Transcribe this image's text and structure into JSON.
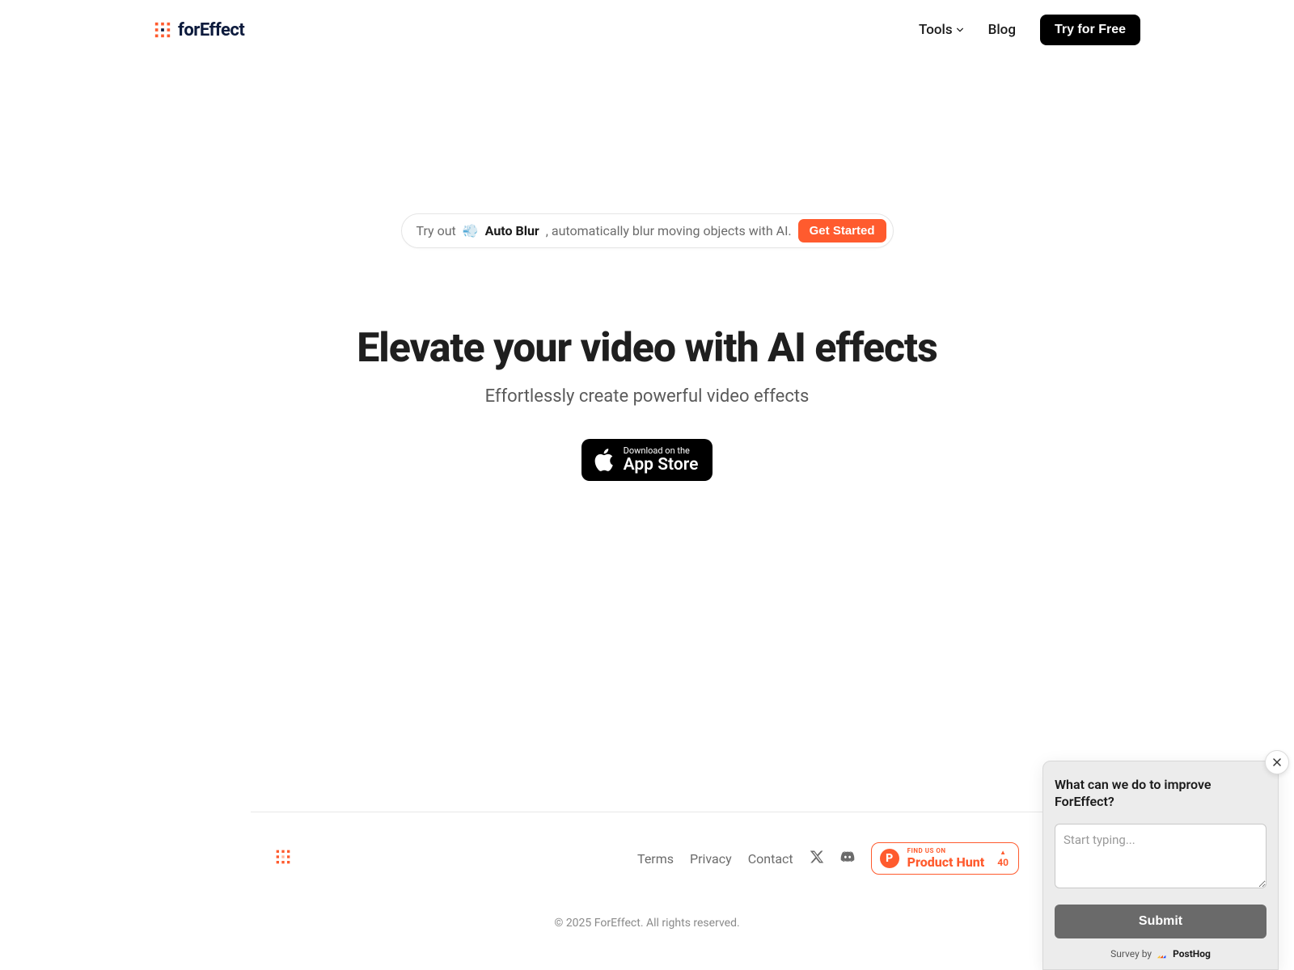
{
  "header": {
    "brand": "forEffect",
    "nav": {
      "tools": "Tools",
      "blog": "Blog",
      "cta": "Try for Free"
    }
  },
  "hero": {
    "pill_prefix": "Try out ",
    "pill_emoji": "💨",
    "pill_bold": "Auto Blur",
    "pill_suffix": ", automatically blur moving objects with AI.",
    "pill_cta": "Get Started",
    "title": "Elevate your video with AI effects",
    "subtitle": "Effortlessly create powerful video effects",
    "appstore_small": "Download on the",
    "appstore_big": "App Store"
  },
  "footer": {
    "links": {
      "terms": "Terms",
      "privacy": "Privacy",
      "contact": "Contact"
    },
    "ph": {
      "small": "FIND US ON",
      "big": "Product Hunt",
      "count": "40"
    },
    "copyright": "© 2025 ForEffect. All rights reserved."
  },
  "survey": {
    "title": "What can we do to improve ForEffect?",
    "placeholder": "Start typing...",
    "submit": "Submit",
    "survey_by": "Survey by",
    "provider": "PostHog"
  },
  "colors": {
    "accent": "#ff5b2e",
    "text": "#1a1a1a",
    "muted": "#6b6b6b"
  }
}
